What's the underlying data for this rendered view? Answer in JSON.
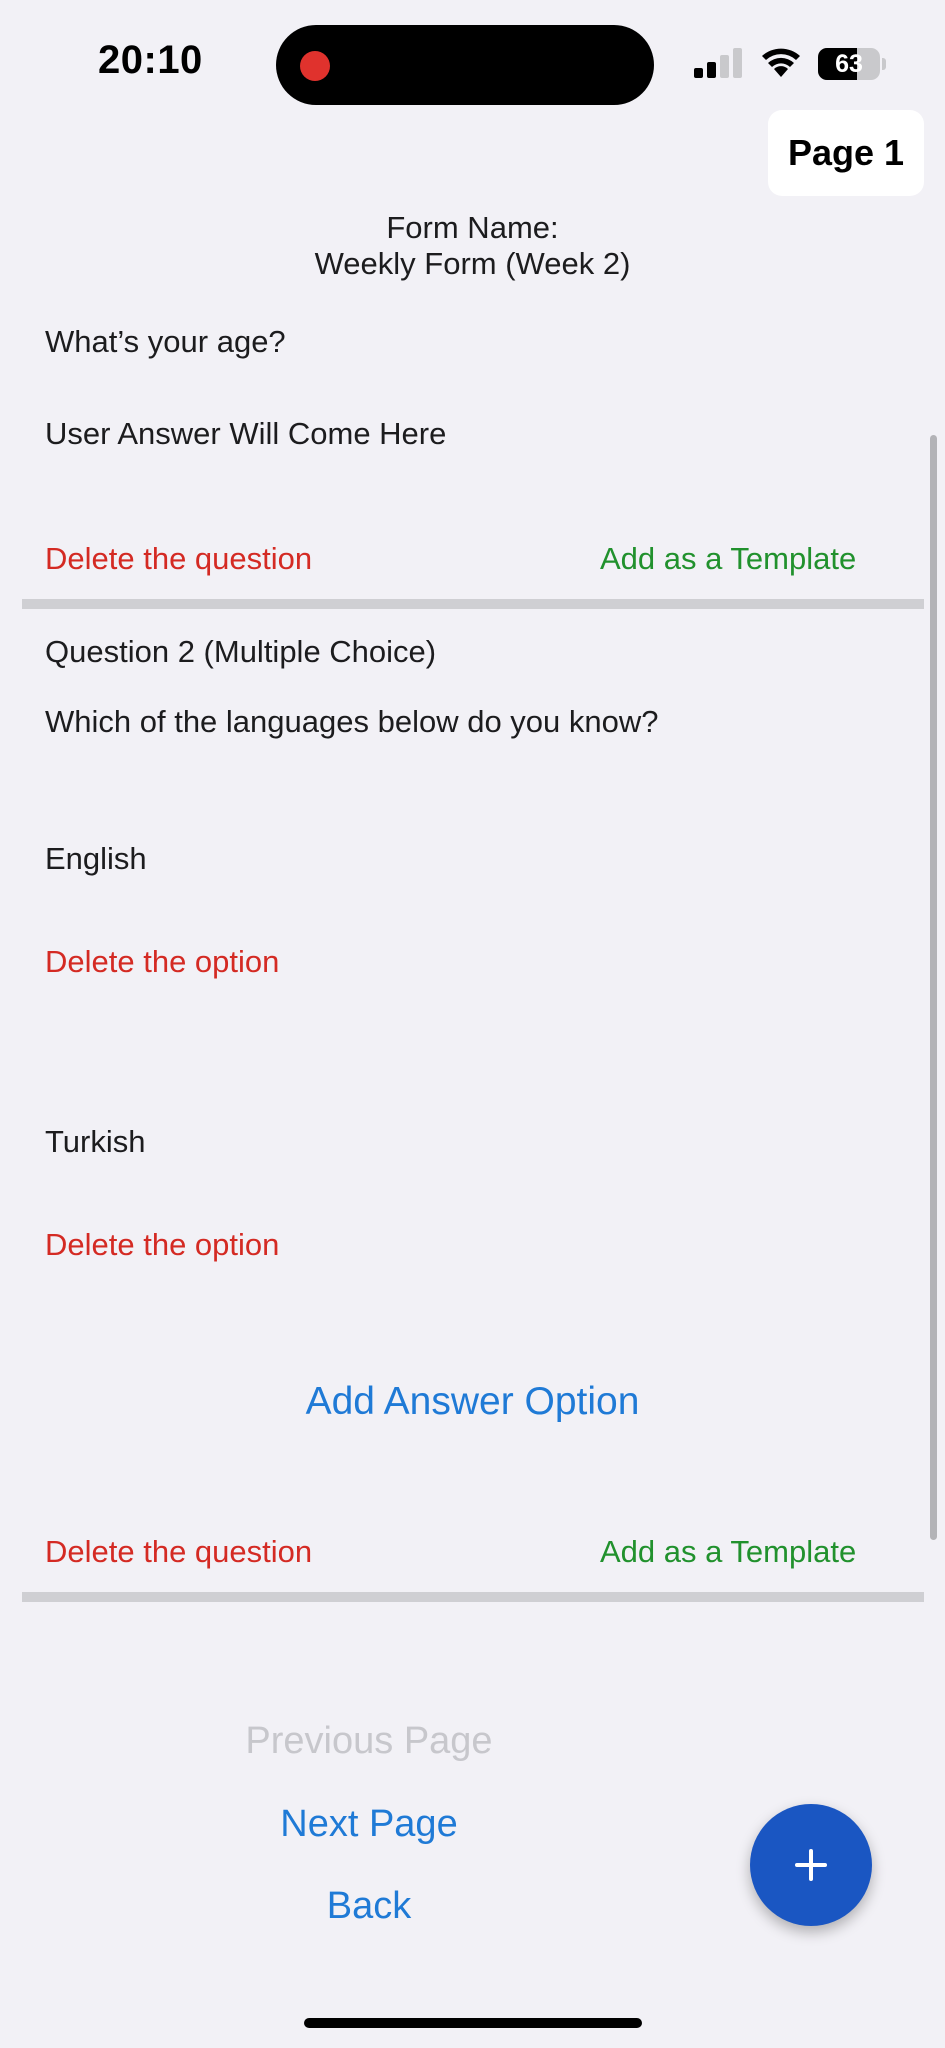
{
  "status_bar": {
    "time": "20:10",
    "battery": "63",
    "battery_level": 0.63
  },
  "header": {
    "page_badge": "Page 1",
    "form_name_label": "Form Name:",
    "form_name": "Weekly Form (Week 2)"
  },
  "question1": {
    "text": "What’s your age?",
    "answer_placeholder": "User Answer Will Come Here",
    "delete_label": "Delete the question",
    "template_label": "Add as a Template"
  },
  "question2": {
    "header": "Question 2 (Multiple Choice)",
    "text": "Which of the languages below do you know?",
    "options": [
      {
        "label": "English",
        "delete_label": "Delete the option"
      },
      {
        "label": "Turkish",
        "delete_label": "Delete the option"
      }
    ],
    "add_option_label": "Add Answer Option",
    "delete_label": "Delete the question",
    "template_label": "Add as a Template"
  },
  "navigation": {
    "previous": "Previous Page",
    "next": "Next Page",
    "back": "Back"
  },
  "fab": {
    "icon": "plus-icon"
  },
  "colors": {
    "background": "#f2f1f6",
    "delete": "#d42a23",
    "template": "#21912d",
    "link": "#1f7ad6",
    "disabled": "#c7c7cc",
    "fab": "#1a56c2"
  }
}
